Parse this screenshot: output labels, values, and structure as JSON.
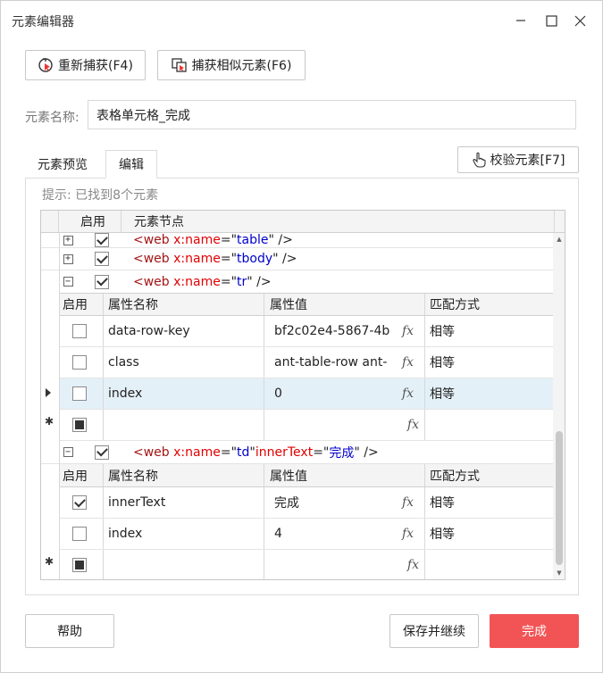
{
  "window": {
    "title": "元素编辑器"
  },
  "toolbar": {
    "recapture_label": "重新捕获(F4)",
    "capture_similar_label": "捕获相似元素(F6)"
  },
  "element_name": {
    "label": "元素名称:",
    "value": "表格单元格_完成"
  },
  "tabs": [
    {
      "label": "元素预览",
      "active": false
    },
    {
      "label": "编辑",
      "active": true
    }
  ],
  "verify_button": {
    "label": "校验元素[F7]"
  },
  "hint": "提示: 已找到8个元素",
  "grid": {
    "header": {
      "enabled": "启用",
      "node": "元素节点"
    },
    "nodes": [
      {
        "tag": "<web",
        "attr1": "x:name",
        "eq1": "=\"",
        "val1": "table",
        "close": "\" />"
      },
      {
        "tag": "<web",
        "attr1": "x:name",
        "eq1": "=\"",
        "val1": "tbody",
        "close": "\" />"
      },
      {
        "tag": "<web",
        "attr1": "x:name",
        "eq1": "=\"",
        "val1": "tr",
        "close": "\" />"
      },
      {
        "tag": "<web",
        "attr1": "x:name",
        "eq1": "=\"",
        "val1": "td",
        "mid": "\" ",
        "attr2": "innerText",
        "eq2": "=\"",
        "val2": "完成",
        "close": "\" />"
      }
    ],
    "sub_header": {
      "enabled": "启用",
      "attr_name": "属性名称",
      "attr_value": "属性值",
      "match": "匹配方式"
    },
    "tr_attrs": [
      {
        "name": "data-row-key",
        "value": "bf2c02e4-5867-4b",
        "match": "相等",
        "checked": false
      },
      {
        "name": "class",
        "value": "ant-table-row ant-",
        "match": "相等",
        "checked": false
      },
      {
        "name": "index",
        "value": "0",
        "match": "相等",
        "checked": false
      }
    ],
    "td_attrs": [
      {
        "name": "innerText",
        "value": "完成",
        "match": "相等",
        "checked": true
      },
      {
        "name": "index",
        "value": "4",
        "match": "相等",
        "checked": false
      }
    ],
    "fx": "fx"
  },
  "footer": {
    "help_label": "帮助",
    "save_continue_label": "保存并继续",
    "done_label": "完成"
  },
  "colors": {
    "done_button": "#f25456",
    "selected_row": "#e4f0f8",
    "tag": "#a31515",
    "attr": "#e00000",
    "value": "#0000cc"
  }
}
